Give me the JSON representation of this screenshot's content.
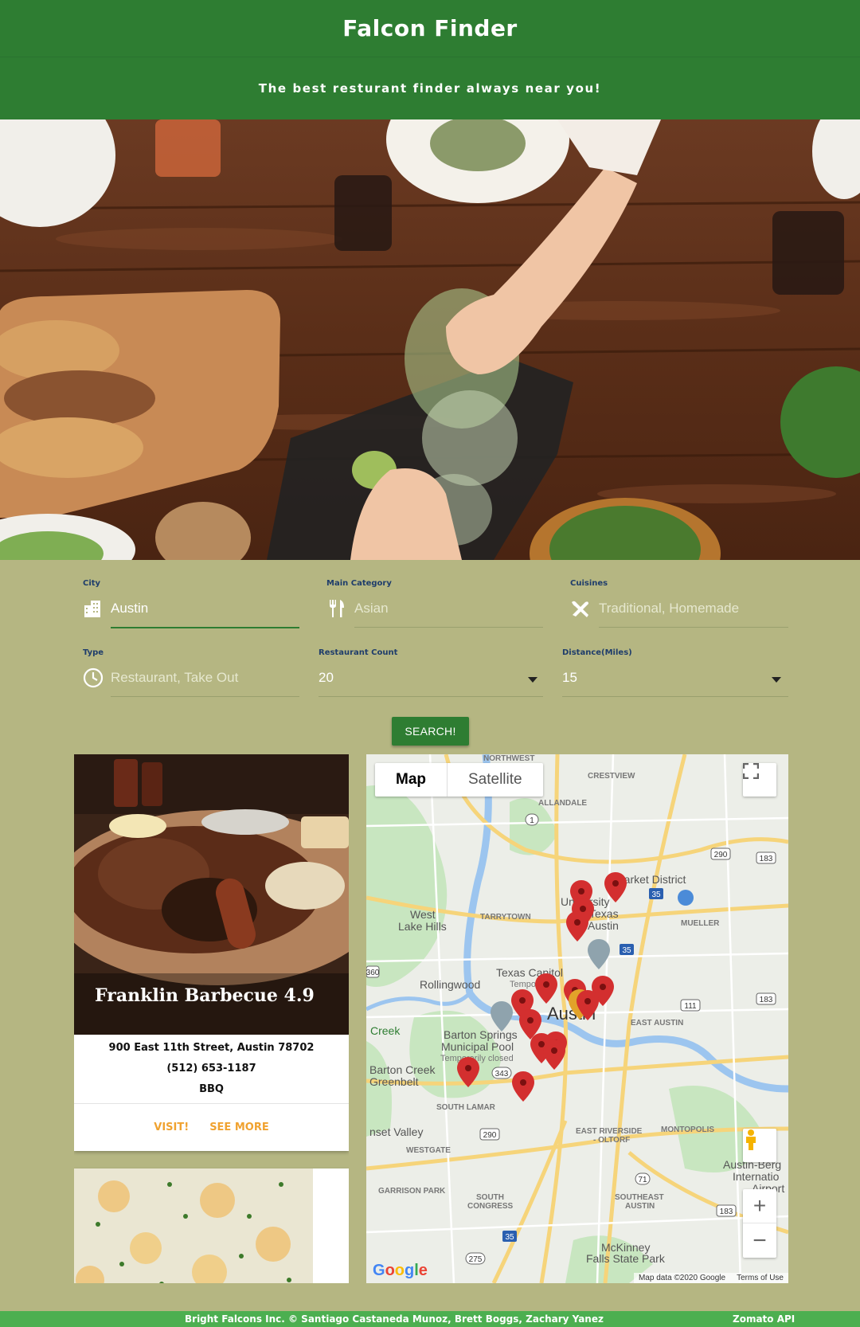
{
  "header": {
    "title": "Falcon Finder",
    "tagline": "The best resturant finder always near you!"
  },
  "form": {
    "city": {
      "label": "City",
      "value": "Austin",
      "icon": "city-icon"
    },
    "main_category": {
      "label": "Main Category",
      "placeholder": "Asian",
      "icon": "fork-knife-icon"
    },
    "cuisines": {
      "label": "Cuisines",
      "placeholder": "Traditional, Homemade",
      "icon": "utensils-cross-icon"
    },
    "type": {
      "label": "Type",
      "placeholder": "Restaurant, Take Out",
      "icon": "clock-icon"
    },
    "restaurant_count": {
      "label": "Restaurant Count",
      "value": "20"
    },
    "distance": {
      "label": "Distance(Miles)",
      "value": "15"
    },
    "search_label": "SEARCH!"
  },
  "results": [
    {
      "name": "Franklin Barbecue 4.9",
      "address": "900 East 11th Street, Austin 78702",
      "phone": "(512) 653-1187",
      "cuisine": "BBQ",
      "visit_label": "VISIT!",
      "more_label": "SEE MORE"
    }
  ],
  "map": {
    "type_map": "Map",
    "type_satellite": "Satellite",
    "attribution": "Map data ©2020 Google",
    "terms": "Terms of Use",
    "labels": [
      "NORTHWEST",
      "CRESTVIEW",
      "ALLANDALE",
      "Market District",
      "University",
      "Texas",
      "Austin",
      "West",
      "Lake Hills",
      "TARRYTOWN",
      "MUELLER",
      "Rollingwood",
      "Texas Capitol",
      "Temporarily",
      "Austin",
      "Barton Springs",
      "Municipal Pool",
      "Temporarily closed",
      "EAST AUSTIN",
      "Creek",
      "Barton Creek",
      "Greenbelt",
      "SOUTH LAMAR",
      "nset Valley",
      "WESTGATE",
      "EAST RIVERSIDE - OLTORF",
      "MONTOPOLIS",
      "GARRISON PARK",
      "SOUTH CONGRESS",
      "SOUTHEAST AUSTIN",
      "Austin-Berg",
      "Internatio",
      "Airport",
      "McKinney",
      "Falls State Park"
    ],
    "route_shields": [
      "1",
      "290",
      "183",
      "35",
      "35",
      "111",
      "183",
      "343",
      "290",
      "71",
      "35",
      "275",
      "183",
      "360"
    ],
    "marker_count": 20
  },
  "footer": {
    "credits": "Bright Falcons Inc. © Santiago Castaneda Munoz, Brett Boggs, Zachary Yanez",
    "api": "Zomato API"
  },
  "colors": {
    "header": "#2e7d32",
    "body": "#b5b682",
    "footer": "#4caf50",
    "accent": "#f0a230",
    "marker": "#d32f2f"
  }
}
